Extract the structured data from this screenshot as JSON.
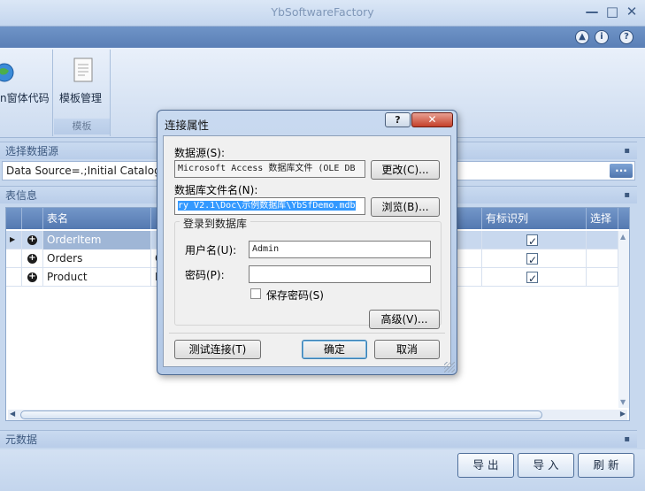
{
  "window": {
    "title": "YbSoftwareFactory",
    "minimize_glyph": "—",
    "maximize_glyph": "□",
    "close_glyph": "✕"
  },
  "toolbar_icons": [
    "collapse-icon",
    "info-icon",
    "help-icon"
  ],
  "ribbon": {
    "items": [
      {
        "label": "n窗体代码",
        "icon": "globe-icon"
      },
      {
        "label": "模板管理",
        "icon": "template-icon"
      }
    ],
    "group_label": "模板"
  },
  "datasource_panel": {
    "title": "选择数据源",
    "value": "Data Source=.;Initial Catalog=",
    "browse_label": "..."
  },
  "table_panel": {
    "title": "表信息",
    "columns": [
      "表名",
      "有标识列",
      "选择"
    ],
    "rows": [
      {
        "name": "OrderItem",
        "c": "",
        "has_identity": true,
        "selected": true
      },
      {
        "name": "Orders",
        "c": "O",
        "has_identity": true,
        "selected": false
      },
      {
        "name": "Product",
        "c": "P",
        "has_identity": true,
        "selected": false
      }
    ]
  },
  "metadata_panel": {
    "title": "元数据"
  },
  "bottom_buttons": {
    "export": "导 出",
    "import": "导 入",
    "refresh": "刷 新"
  },
  "dialog": {
    "title": "连接属性",
    "help_glyph": "?",
    "close_glyph": "✕",
    "datasource_label": "数据源(S):",
    "datasource_value": "Microsoft Access 数据库文件 (OLE DB",
    "change_button": "更改(C)...",
    "filename_label": "数据库文件名(N):",
    "filename_value": "ry V2.1\\Doc\\示例数据库\\YbSfDemo.mdb",
    "browse_button": "浏览(B)...",
    "login_group": "登录到数据库",
    "username_label": "用户名(U):",
    "username_value": "Admin",
    "password_label": "密码(P):",
    "password_value": "",
    "save_password_label": "保存密码(S)",
    "save_password_checked": false,
    "advanced_button": "高级(V)...",
    "test_button": "测试连接(T)",
    "ok_button": "确定",
    "cancel_button": "取消"
  }
}
